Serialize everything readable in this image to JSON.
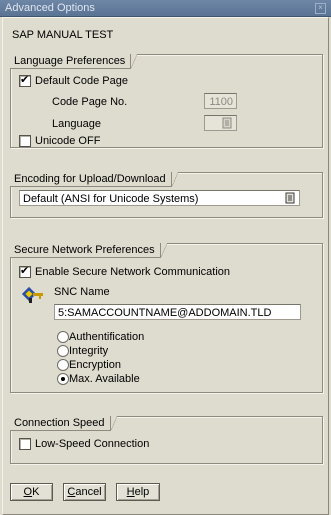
{
  "window": {
    "title": "Advanced Options",
    "close_symbol": "×"
  },
  "system_label": "SAP MANUAL TEST",
  "language_preferences": {
    "title": "Language Preferences",
    "default_code_page": {
      "label": "Default Code Page",
      "checked": true
    },
    "code_page_no": {
      "label": "Code Page No.",
      "value": "1100"
    },
    "language": {
      "label": "Language",
      "value": ""
    },
    "unicode_off": {
      "label": "Unicode OFF",
      "checked": false
    }
  },
  "encoding": {
    "title": "Encoding for Upload/Download",
    "selected": "Default (ANSI for Unicode Systems)"
  },
  "secure_network": {
    "title": "Secure Network Preferences",
    "enable_snc": {
      "label": "Enable Secure Network Communication",
      "checked": true
    },
    "snc_name_label": "SNC Name",
    "snc_name_value": "5:SAMACCOUNTNAME@ADDOMAIN.TLD",
    "protection_levels": [
      {
        "label": "Authentification",
        "selected": false
      },
      {
        "label": "Integrity",
        "selected": false
      },
      {
        "label": "Encryption",
        "selected": false
      },
      {
        "label": "Max. Available",
        "selected": true
      }
    ]
  },
  "connection_speed": {
    "title": "Connection Speed",
    "low_speed": {
      "label": "Low-Speed Connection",
      "checked": false
    }
  },
  "buttons": {
    "ok": {
      "mnemonic": "O",
      "rest": "K"
    },
    "cancel": {
      "mnemonic": "C",
      "rest": "ancel"
    },
    "help": {
      "mnemonic": "H",
      "rest": "elp"
    }
  },
  "colors": {
    "background": "#dedbcf",
    "titlebar": "#6f87a6",
    "border": "#8e8a7e"
  }
}
